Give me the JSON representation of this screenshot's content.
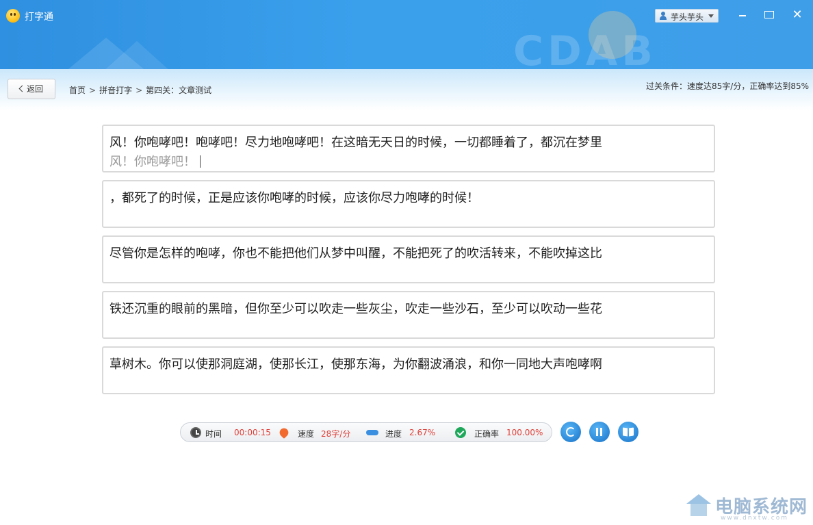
{
  "app": {
    "title": "打字通"
  },
  "window": {
    "user_label": "芋头芋头"
  },
  "nav": {
    "back_label": "返回",
    "breadcrumb": [
      "首页",
      "拼音打字",
      "第四关：文章测试"
    ],
    "pass_condition": "过关条件：速度达85字/分，正确率达到85%"
  },
  "lines": [
    {
      "source": "风！你咆哮吧！咆哮吧！尽力地咆哮吧！在这暗无天日的时候，一切都睡着了，都沉在梦里",
      "typed": "风！你咆哮吧！"
    },
    {
      "source": "，都死了的时候，正是应该你咆哮的时候，应该你尽力咆哮的时候！",
      "typed": ""
    },
    {
      "source": "尽管你是怎样的咆哮，你也不能把他们从梦中叫醒，不能把死了的吹活转来，不能吹掉这比",
      "typed": ""
    },
    {
      "source": "铁还沉重的眼前的黑暗，但你至少可以吹走一些灰尘，吹走一些沙石，至少可以吹动一些花",
      "typed": ""
    },
    {
      "source": "草树木。你可以使那洞庭湖，使那长江，使那东海，为你翻波涌浪，和你一同地大声咆哮啊",
      "typed": ""
    }
  ],
  "stats": {
    "time_label": "时间",
    "time_value": "00:00:15",
    "speed_label": "速度",
    "speed_value": "28字/分",
    "progress_label": "进度",
    "progress_value": "2.67%",
    "accuracy_label": "正确率",
    "accuracy_value": "100.00%"
  },
  "watermark": {
    "text": "电脑系统网",
    "sub": "www.dnxtw.com"
  },
  "colors": {
    "accent": "#2f8fe0",
    "stat_value": "#e0413a",
    "typed_text": "#9a9a9a"
  }
}
